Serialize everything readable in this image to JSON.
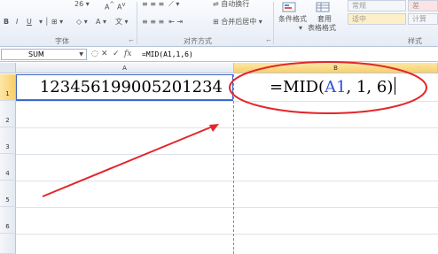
{
  "ribbon": {
    "font_size_value": "26",
    "increase_font_label": "A",
    "decrease_font_label": "A",
    "bold_label": "B",
    "italic_label": "I",
    "underline_label": "U",
    "font_group_label": "字体",
    "align_group_label": "对齐方式",
    "wrap_text_label": "自动换行",
    "merge_center_label": "合并后居中",
    "conditional_format_label": "条件格式",
    "table_format_label": "套用",
    "table_format_label2": "表格格式",
    "style_normal": "常规",
    "style_moderate": "适中",
    "style_bad": "差",
    "style_calc": "计算",
    "styles_group_label": "样式"
  },
  "formula_bar": {
    "name_box": "SUM",
    "fx_label": "fx",
    "formula": "=MID(A1,1,6)"
  },
  "columns": [
    "A",
    "B"
  ],
  "rows": [
    "1",
    "2",
    "3",
    "4",
    "5",
    "6"
  ],
  "cells": {
    "A1": "123456199005201234",
    "B1_prefix": "=MID(",
    "B1_ref": "A1",
    "B1_suffix": ", 1, 6)"
  },
  "annotation_colors": {
    "ellipse": "#e3262a",
    "arrow": "#e3262a"
  }
}
